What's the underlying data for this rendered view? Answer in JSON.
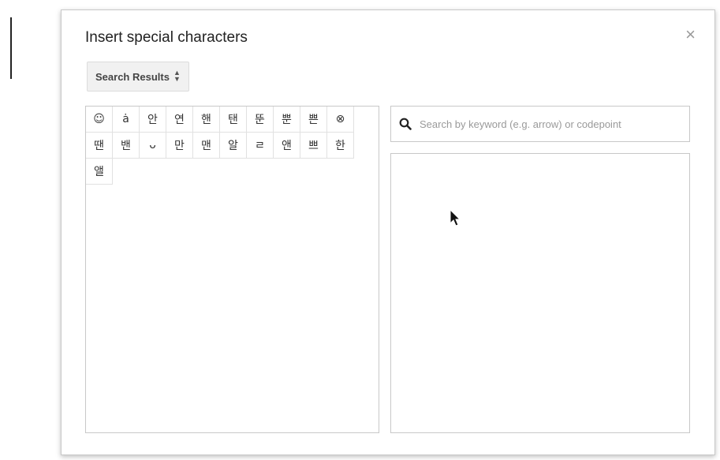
{
  "dialog": {
    "title": "Insert special characters",
    "close_glyph": "×",
    "category_select": {
      "label": "Search Results",
      "arrow_up": "▲",
      "arrow_down": "▼"
    },
    "characters": [
      "☺",
      "ȧ",
      "안",
      "연",
      "핸",
      "탠",
      "뚠",
      "뿐",
      "쁜",
      "⊗",
      "땐",
      "밴",
      "ᴗ",
      "만",
      "맨",
      "알",
      "ㄹ",
      "앤",
      "쁘",
      "한",
      "앨"
    ],
    "search": {
      "placeholder": "Search by keyword (e.g. arrow) or codepoint",
      "value": ""
    }
  },
  "icons": {
    "search": "magnifier-icon",
    "close": "close-icon",
    "cursor": "mouse-pointer-icon"
  },
  "colors": {
    "border": "#c8c8c8",
    "title": "#222222",
    "placeholder": "#9a9a9a"
  }
}
